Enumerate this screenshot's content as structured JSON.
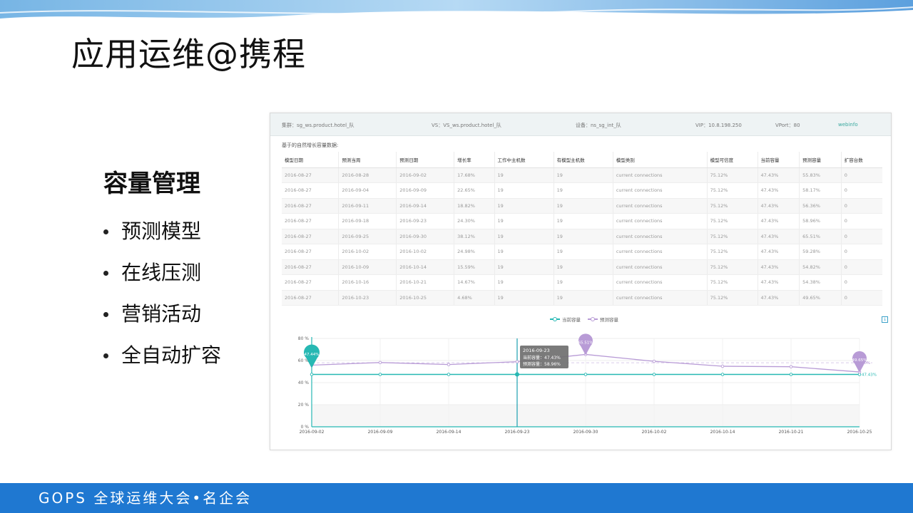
{
  "slide": {
    "title": "应用运维@携程",
    "heading": "容量管理",
    "bullets": [
      "预测模型",
      "在线压测",
      "营销活动",
      "全自动扩容"
    ],
    "footer": "GOPS 全球运维大会•名企会"
  },
  "screenshot": {
    "info": {
      "cluster": "集群：sg_ws.product.hotel_队",
      "vs": "VS：VS_ws.product.hotel_队",
      "device": "设备：ns_sg_int_队",
      "vip": "VIP：10.8.198.250",
      "vport": "VPort：80",
      "link": "webinfo"
    },
    "caption": "基于的自然增长容量数据:",
    "table": {
      "headers": [
        "模型日期",
        "预测当周",
        "预测日期",
        "增长率",
        "工作中主机数",
        "有模型主机数",
        "模型类别",
        "模型可信度",
        "当前容量",
        "预测容量",
        "扩容台数"
      ],
      "rows": [
        [
          "2016-08-27",
          "2016-08-28",
          "2016-09-02",
          "17.68%",
          "19",
          "19",
          "current connections",
          "75.12%",
          "47.43%",
          "55.83%",
          "0"
        ],
        [
          "2016-08-27",
          "2016-09-04",
          "2016-09-09",
          "22.65%",
          "19",
          "19",
          "current connections",
          "75.12%",
          "47.43%",
          "58.17%",
          "0"
        ],
        [
          "2016-08-27",
          "2016-09-11",
          "2016-09-14",
          "18.82%",
          "19",
          "19",
          "current connections",
          "75.12%",
          "47.43%",
          "56.36%",
          "0"
        ],
        [
          "2016-08-27",
          "2016-09-18",
          "2016-09-23",
          "24.30%",
          "19",
          "19",
          "current connections",
          "75.12%",
          "47.43%",
          "58.96%",
          "0"
        ],
        [
          "2016-08-27",
          "2016-09-25",
          "2016-09-30",
          "38.12%",
          "19",
          "19",
          "current connections",
          "75.12%",
          "47.43%",
          "65.51%",
          "0"
        ],
        [
          "2016-08-27",
          "2016-10-02",
          "2016-10-02",
          "24.98%",
          "19",
          "19",
          "current connections",
          "75.12%",
          "47.43%",
          "59.28%",
          "0"
        ],
        [
          "2016-08-27",
          "2016-10-09",
          "2016-10-14",
          "15.59%",
          "19",
          "19",
          "current connections",
          "75.12%",
          "47.43%",
          "54.82%",
          "0"
        ],
        [
          "2016-08-27",
          "2016-10-16",
          "2016-10-21",
          "14.67%",
          "19",
          "19",
          "current connections",
          "75.12%",
          "47.43%",
          "54.38%",
          "0"
        ],
        [
          "2016-08-27",
          "2016-10-23",
          "2016-10-25",
          "4.68%",
          "19",
          "19",
          "current connections",
          "75.12%",
          "47.43%",
          "49.65%",
          "0"
        ]
      ]
    },
    "legend": {
      "current": "当前容量",
      "forecast": "预测容量"
    },
    "tooltip": {
      "date": "2016-09-23",
      "current_line": "当前容量：47.43%",
      "forecast_line": "预测容量：58.96%"
    },
    "pins": {
      "start": "47.44%",
      "max": "65.51%",
      "end": "49.65%"
    },
    "end_labels": {
      "forecast": "50%",
      "current": "47.43%"
    }
  },
  "colors": {
    "current": "#26b8b3",
    "forecast": "#b89bd6",
    "footer": "#1f78d1"
  },
  "chart_data": {
    "type": "line",
    "x": [
      "2016-09-02",
      "2016-09-09",
      "2016-09-14",
      "2016-09-23",
      "2016-09-30",
      "2016-10-02",
      "2016-10-14",
      "2016-10-21",
      "2016-10-25"
    ],
    "yticks": [
      "0 %",
      "20 %",
      "40 %",
      "60 %",
      "80 %"
    ],
    "ylim": [
      0,
      80
    ],
    "series": [
      {
        "name": "当前容量",
        "values": [
          47.43,
          47.43,
          47.43,
          47.43,
          47.43,
          47.43,
          47.43,
          47.43,
          47.43
        ]
      },
      {
        "name": "预测容量",
        "values": [
          55.83,
          58.17,
          56.36,
          58.96,
          65.51,
          59.28,
          54.82,
          54.38,
          49.65
        ]
      }
    ],
    "reference_line": 58
  }
}
